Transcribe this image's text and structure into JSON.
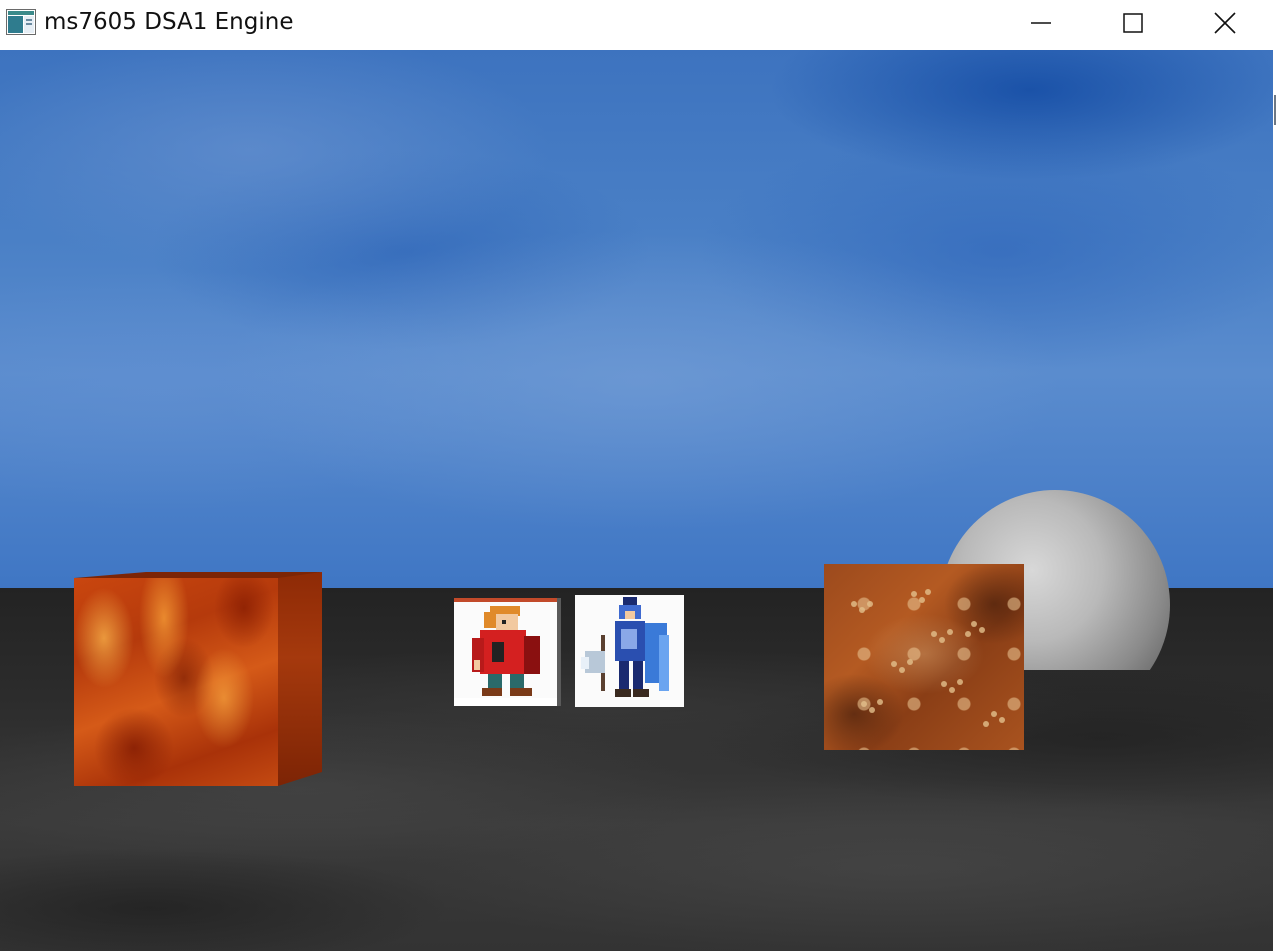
{
  "window": {
    "title": "ms7605 DSA1 Engine",
    "controls": {
      "minimize": "minimize-icon",
      "maximize": "maximize-icon",
      "close": "close-icon"
    }
  },
  "scene": {
    "sky_color": "#4a80c6",
    "ground_color": "#2c2c2c",
    "objects": [
      {
        "kind": "cube",
        "texture": "fire",
        "color": "#c9460f"
      },
      {
        "kind": "cube",
        "texture": "sprite-red-cloak-character",
        "color": "#d42020"
      },
      {
        "kind": "cube",
        "texture": "sprite-blue-armored-axe-knight",
        "color": "#2a4fb0"
      },
      {
        "kind": "cube",
        "texture": "rocky-orange-surface",
        "color": "#a9531f"
      },
      {
        "kind": "sphere",
        "material": "grey",
        "color": "#9a9a9a"
      }
    ]
  }
}
